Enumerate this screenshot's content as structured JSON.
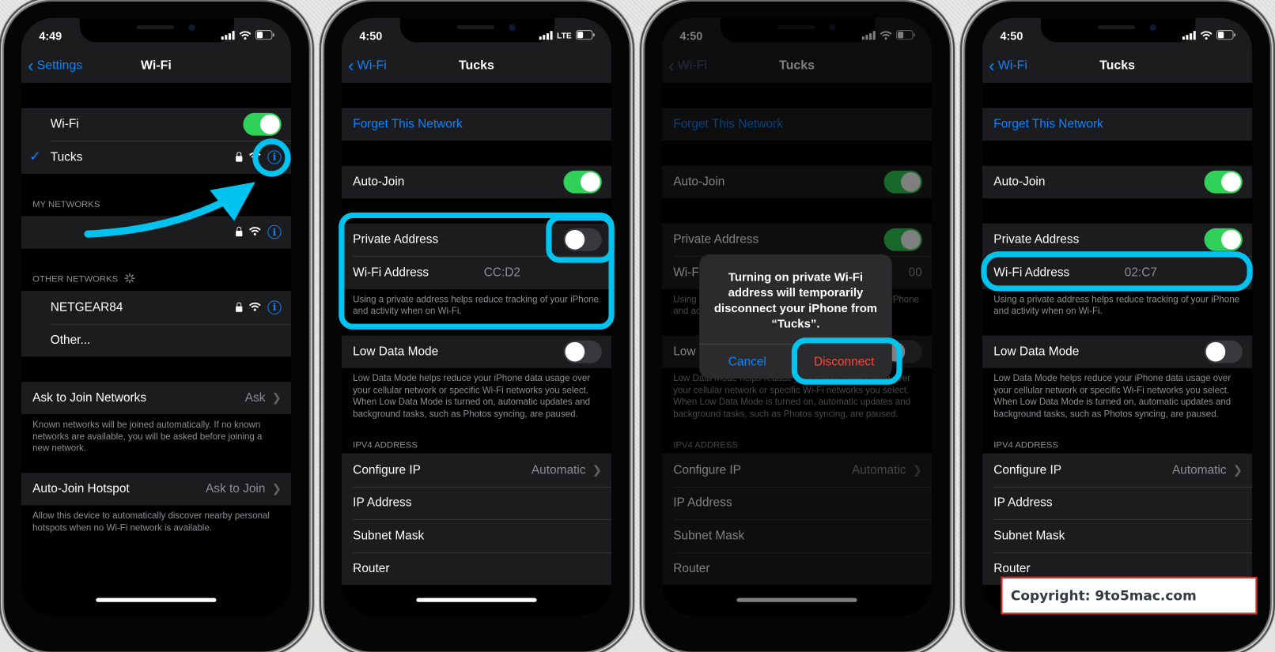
{
  "colors": {
    "accent_blue": "#0a84ff",
    "toggle_on": "#30d158",
    "highlight": "#00c3f0",
    "destructive": "#ff453a"
  },
  "phones": [
    {
      "status": {
        "time": "4:49",
        "carrier": ""
      },
      "nav": {
        "back": "Settings",
        "title": "Wi-Fi",
        "back_enabled": true
      },
      "sections": [
        {
          "type": "group",
          "rows": [
            {
              "label": "Wi-Fi",
              "indent": true,
              "toggle": "on"
            },
            {
              "label": "Tucks",
              "indent": true,
              "check": true,
              "lock": true,
              "wifi": true,
              "info": true
            }
          ]
        },
        {
          "type": "header",
          "text": "MY NETWORKS"
        },
        {
          "type": "group",
          "rows": [
            {
              "label": "",
              "indent": true,
              "lock": true,
              "wifi": true,
              "info": true
            }
          ]
        },
        {
          "type": "header",
          "text": "OTHER NETWORKS",
          "spinner": true
        },
        {
          "type": "group",
          "rows": [
            {
              "label": "NETGEAR84",
              "indent": true,
              "lock": true,
              "wifi": true,
              "info": true
            },
            {
              "label": "Other...",
              "indent": true
            }
          ]
        },
        {
          "type": "group",
          "rows": [
            {
              "label": "Ask to Join Networks",
              "value": "Ask",
              "chevron": true
            }
          ]
        },
        {
          "type": "footer",
          "text": "Known networks will be joined automatically. If no known networks are available, you will be asked before joining a new network."
        },
        {
          "type": "group",
          "rows": [
            {
              "label": "Auto-Join Hotspot",
              "value": "Ask to Join",
              "chevron": true
            }
          ]
        },
        {
          "type": "footer",
          "text": "Allow this device to automatically discover nearby personal hotspots when no Wi-Fi network is available."
        }
      ]
    },
    {
      "status": {
        "time": "4:50",
        "carrier": "LTE"
      },
      "nav": {
        "back": "Wi-Fi",
        "title": "Tucks",
        "back_enabled": true
      },
      "sections": [
        {
          "type": "group",
          "rows": [
            {
              "label": "Forget This Network",
              "link": true
            }
          ]
        },
        {
          "type": "group",
          "rows": [
            {
              "label": "Auto-Join",
              "toggle": "on"
            }
          ]
        },
        {
          "type": "group",
          "rows": [
            {
              "label": "Private Address",
              "toggle": "off"
            },
            {
              "label": "Wi-Fi Address",
              "mac": "CC:D2"
            }
          ]
        },
        {
          "type": "footer",
          "text": "Using a private address helps reduce tracking of your iPhone and activity when on Wi-Fi."
        },
        {
          "type": "group",
          "rows": [
            {
              "label": "Low Data Mode",
              "toggle": "off"
            }
          ]
        },
        {
          "type": "footer",
          "text": "Low Data Mode helps reduce your iPhone data usage over your cellular network or specific Wi-Fi networks you select. When Low Data Mode is turned on, automatic updates and background tasks, such as Photos syncing, are paused."
        },
        {
          "type": "header",
          "text": "IPV4 ADDRESS"
        },
        {
          "type": "group",
          "rows": [
            {
              "label": "Configure IP",
              "value": "Automatic",
              "chevron": true
            },
            {
              "label": "IP Address"
            },
            {
              "label": "Subnet Mask"
            },
            {
              "label": "Router"
            }
          ]
        }
      ]
    },
    {
      "status": {
        "time": "4:50",
        "carrier": ""
      },
      "nav": {
        "back": "Wi-Fi",
        "title": "Tucks",
        "back_enabled": false
      },
      "sections": [
        {
          "type": "group",
          "rows": [
            {
              "label": "Forget This Network",
              "link": true
            }
          ]
        },
        {
          "type": "group",
          "rows": [
            {
              "label": "Auto-Join",
              "toggle": "on"
            }
          ]
        },
        {
          "type": "group",
          "rows": [
            {
              "label": "Private Address",
              "toggle": "on"
            },
            {
              "label": "Wi-Fi Address",
              "value": "00"
            }
          ]
        },
        {
          "type": "footer",
          "text": "Using a private address helps reduce tracking of your iPhone and activity when on Wi-Fi."
        },
        {
          "type": "group",
          "rows": [
            {
              "label": "Low Data Mode",
              "toggle": "off"
            }
          ]
        },
        {
          "type": "footer",
          "text": "Low Data Mode helps reduce your iPhone data usage over your cellular network or specific Wi-Fi networks you select. When Low Data Mode is turned on, automatic updates and background tasks, such as Photos syncing, are paused."
        },
        {
          "type": "header",
          "text": "IPV4 ADDRESS"
        },
        {
          "type": "group",
          "rows": [
            {
              "label": "Configure IP",
              "value": "Automatic",
              "chevron": true
            },
            {
              "label": "IP Address"
            },
            {
              "label": "Subnet Mask"
            },
            {
              "label": "Router"
            }
          ]
        }
      ],
      "alert": {
        "message": "Turning on private Wi-Fi address will temporarily disconnect your iPhone from “Tucks”.",
        "cancel": "Cancel",
        "confirm": "Disconnect"
      }
    },
    {
      "status": {
        "time": "4:50",
        "carrier": ""
      },
      "nav": {
        "back": "Wi-Fi",
        "title": "Tucks",
        "back_enabled": true
      },
      "sections": [
        {
          "type": "group",
          "rows": [
            {
              "label": "Forget This Network",
              "link": true
            }
          ]
        },
        {
          "type": "group",
          "rows": [
            {
              "label": "Auto-Join",
              "toggle": "on"
            }
          ]
        },
        {
          "type": "group",
          "rows": [
            {
              "label": "Private Address",
              "toggle": "on"
            },
            {
              "label": "Wi-Fi Address",
              "mac": "02:C7"
            }
          ]
        },
        {
          "type": "footer",
          "text": "Using a private address helps reduce tracking of your iPhone and activity when on Wi-Fi."
        },
        {
          "type": "group",
          "rows": [
            {
              "label": "Low Data Mode",
              "toggle": "off"
            }
          ]
        },
        {
          "type": "footer",
          "text": "Low Data Mode helps reduce your iPhone data usage over your cellular network or specific Wi-Fi networks you select. When Low Data Mode is turned on, automatic updates and background tasks, such as Photos syncing, are paused."
        },
        {
          "type": "header",
          "text": "IPV4 ADDRESS"
        },
        {
          "type": "group",
          "rows": [
            {
              "label": "Configure IP",
              "value": "Automatic",
              "chevron": true
            },
            {
              "label": "IP Address"
            },
            {
              "label": "Subnet Mask"
            },
            {
              "label": "Router"
            }
          ]
        }
      ]
    }
  ],
  "watermark": {
    "text": "Copyright: 9to5mac.com"
  }
}
